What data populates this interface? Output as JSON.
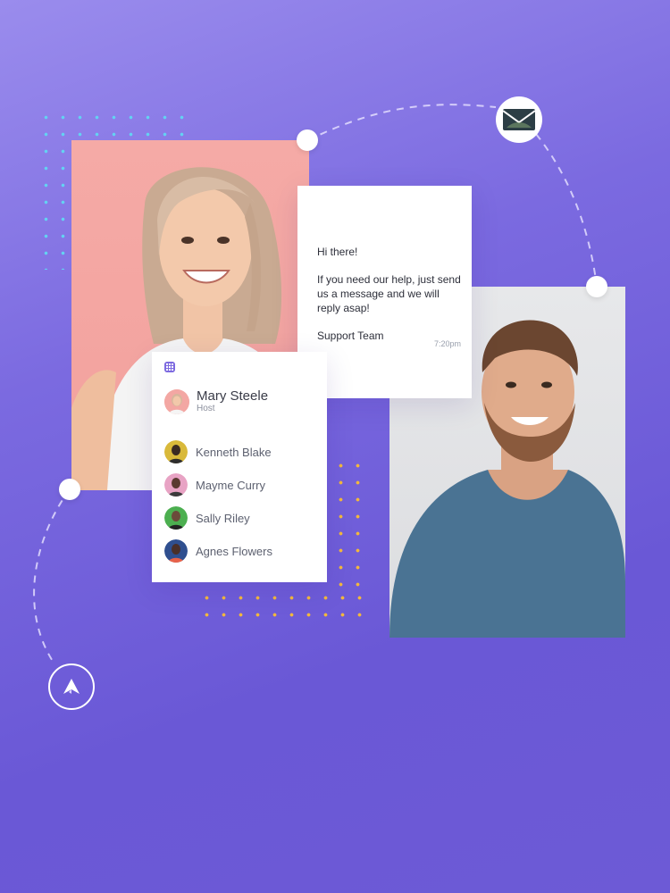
{
  "message": {
    "greeting": "Hi there!",
    "body": "If you need our help, just send us a message and we will reply asap!",
    "signature": "Support Team",
    "time": "7:20pm"
  },
  "participants": {
    "host": {
      "name": "Mary Steele",
      "role": "Host"
    },
    "members": [
      {
        "name": "Kenneth Blake"
      },
      {
        "name": "Mayme Curry"
      },
      {
        "name": "Sally Riley"
      },
      {
        "name": "Agnes Flowers"
      }
    ]
  },
  "icons": {
    "top_badge": "envelope-icon",
    "bottom_badge": "paper-plane-icon",
    "list_header": "grid-icon"
  },
  "colors": {
    "background": "#7b6ae0",
    "accent": "#7d6ae0",
    "dots_cyan": "#63d3f2",
    "dots_yellow": "#f3b83c",
    "woman_backdrop": "#f5aaa6"
  }
}
